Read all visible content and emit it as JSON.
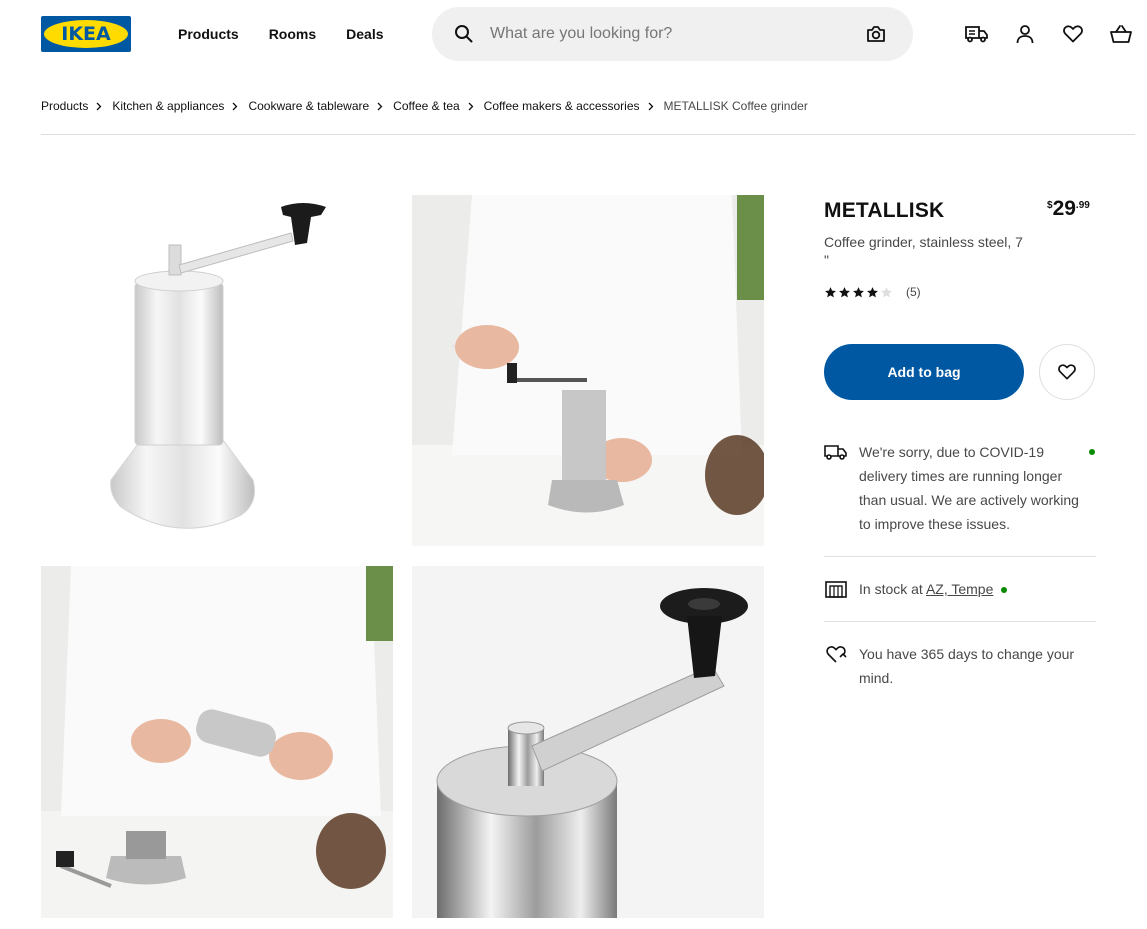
{
  "header": {
    "logo_text": "IKEA",
    "nav": [
      {
        "label": "Products"
      },
      {
        "label": "Rooms"
      },
      {
        "label": "Deals"
      }
    ],
    "search": {
      "placeholder": "What are you looking for?",
      "value": ""
    },
    "icons": [
      "truck-icon",
      "user-icon",
      "heart-icon",
      "cart-icon"
    ]
  },
  "breadcrumb": [
    "Products",
    "Kitchen & appliances",
    "Cookware & tableware",
    "Coffee & tea",
    "Coffee makers & accessories",
    "METALLISK Coffee grinder"
  ],
  "gallery": {
    "images": [
      "coffee-grinder-product",
      "coffee-grinder-in-use",
      "coffee-grinder-disassembled",
      "coffee-grinder-closeup"
    ]
  },
  "product": {
    "name": "METALLISK",
    "price": {
      "currency": "$",
      "integer": "29",
      "decimal": ".99"
    },
    "description_line1": "Coffee grinder, stainless steel, 7",
    "description_line2": "\"",
    "rating": {
      "stars": 4,
      "max": 5,
      "count_label": "(5)"
    },
    "add_to_bag_label": "Add to bag"
  },
  "info": {
    "delivery_text": "We're sorry, due to COVID-19 delivery times are running longer than usual. We are actively working to improve these issues.",
    "stock_prefix": "In stock at ",
    "stock_store": "AZ, Tempe",
    "return_text": "You have 365 days to change your mind."
  },
  "colors": {
    "brand_blue": "#0058a3",
    "brand_yellow": "#ffdb00",
    "status_green": "#0a8a00"
  }
}
